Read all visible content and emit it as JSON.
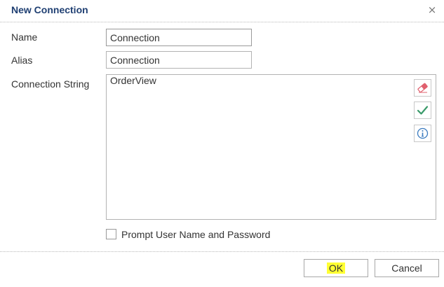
{
  "dialog": {
    "title": "New Connection",
    "close_symbol": "×",
    "close_icon": "close-icon"
  },
  "form": {
    "name_label": "Name",
    "name_value": "Connection",
    "alias_label": "Alias",
    "alias_value": "Connection",
    "connection_string_label": "Connection String",
    "connection_string_value": "OrderView",
    "tools": [
      {
        "icon": "eraser-icon",
        "color": "#e0606e"
      },
      {
        "icon": "checkmark-icon",
        "color": "#3a9a6a"
      },
      {
        "icon": "info-icon",
        "color": "#3b7bbf"
      }
    ],
    "prompt_checkbox_label": "Prompt User Name and Password",
    "prompt_checked": false
  },
  "footer": {
    "ok_label": "OK",
    "cancel_label": "Cancel",
    "highlight_color": "#ffff33"
  },
  "colors": {
    "title": "#1f3f72",
    "border": "#b3b3b3"
  }
}
